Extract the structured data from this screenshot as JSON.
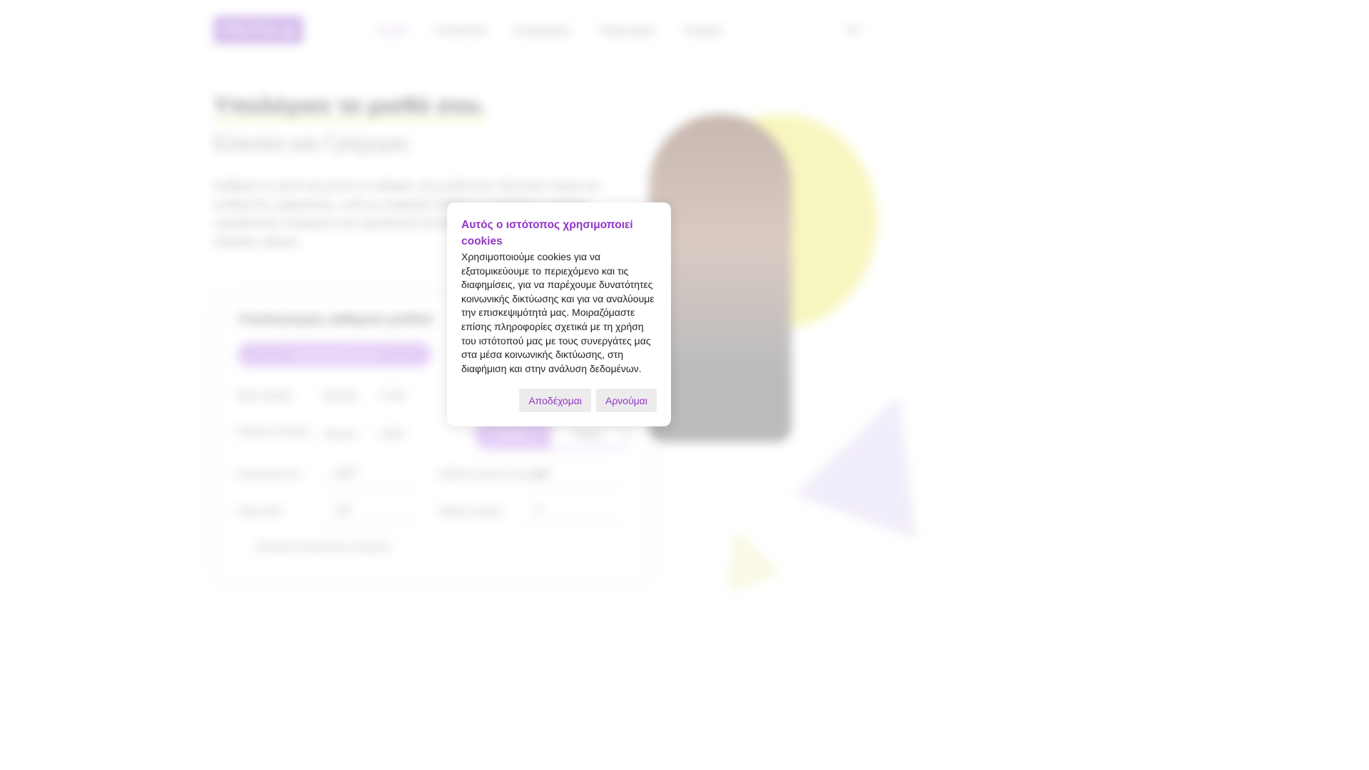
{
  "header": {
    "logo_text": "AllesTax.gr",
    "nav_items": [
      "Αρχική",
      "Αποκοπικοί",
      "Επιχειρήσεις",
      "Κληρονομιές",
      "Εταιρικά"
    ],
    "language": "EN"
  },
  "hero": {
    "title": "Υπολόγισε το μισθό σου.",
    "subtitle": "Εύκολα και Γρήγορα.",
    "text": "Καθαρό σε μικτό και μικτό σε καθαρό, για μισθωτούς ιδιωτικού τομέα και μισθωτούς μηχανικούς, μαζί με εισφορές ΕΦΚΑ και κρατήσεις εφορίας, εργοδοτικών εισφορών και εργοδοτικό κόστος με συντελεστές 2025 και κλίμακες φόρου."
  },
  "calculator": {
    "title": "Υπολογισμός καθαρού μισθού",
    "button_label": "Υπολογισμός Μισθού",
    "gross_label": "Μικτές Μισθός",
    "gross_period": "Μηνιαίες",
    "gross_value": "1710€",
    "net_label": "Καθαρές Αποδοχές",
    "net_period": "Μηνιαίες",
    "net_value": "1400€",
    "toggle_on": "Μηνιαίες",
    "toggle_off": "Ετήσιες",
    "year_label": "Φορολογικό έτος",
    "year_value": "2025",
    "payments_label": "Αριθμός μηνιαίων πληρωμών",
    "payments_value": "14",
    "children_label": "Ηλικία μισθ.",
    "children_value": "<25",
    "dependents_label": "Αριθμός παιδιών",
    "dependents_value": "0",
    "checkbox_label": "Μετατροπή εργοδοτικών εισφορών"
  },
  "cookie": {
    "title": "Αυτός ο ιστότοπος χρησιμοποιεί cookies",
    "body": "Χρησιμοποιούμε cookies για να εξατομικεύουμε το περιεχόμενο και τις διαφημίσεις, για να παρέχουμε δυνατότητες κοινωνικής δικτύωσης και για να αναλύουμε την επισκεψιμότητά μας. Μοιραζόμαστε επίσης πληροφορίες σχετικά με τη χρήση του ιστότοπού μας με τους συνεργάτες μας στα μέσα κοινωνικής δικτύωσης, στη διαφήμιση και στην ανάλυση δεδομένων.",
    "accept_label": "Αποδέχομαι",
    "reject_label": "Αρνούμαι"
  },
  "colors": {
    "accent": "#9235c6",
    "brand": "#a06ad6",
    "yellow": "#f1ee7a"
  }
}
